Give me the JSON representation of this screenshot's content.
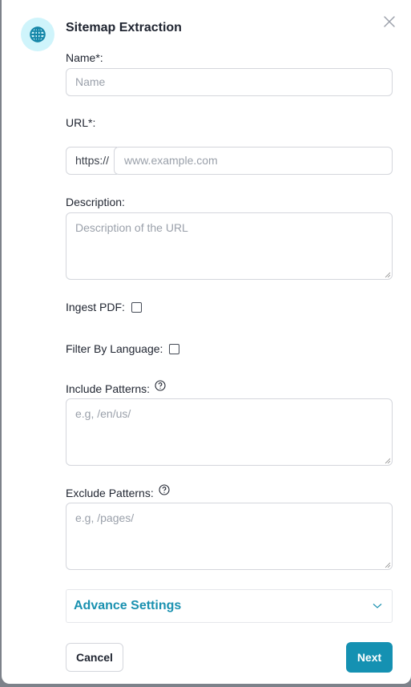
{
  "dialog": {
    "title": "Sitemap Extraction",
    "icon": "globe-icon",
    "close_icon": "close-icon"
  },
  "form": {
    "name": {
      "label": "Name*:",
      "placeholder": "Name",
      "value": ""
    },
    "url": {
      "label": "URL*:",
      "prefix": "https://",
      "placeholder": "www.example.com",
      "value": ""
    },
    "description": {
      "label": "Description:",
      "placeholder": "Description of the URL",
      "value": ""
    },
    "ingest_pdf": {
      "label": "Ingest PDF:",
      "checked": false
    },
    "filter_by_language": {
      "label": "Filter By Language:",
      "checked": false
    },
    "include_patterns": {
      "label": "Include Patterns:",
      "placeholder": "e.g, /en/us/",
      "value": "",
      "help_icon": "help-circle-icon"
    },
    "exclude_patterns": {
      "label": "Exclude Patterns:",
      "placeholder": "e.g, /pages/",
      "value": "",
      "help_icon": "help-circle-icon"
    }
  },
  "advanced": {
    "label": "Advance Settings",
    "expanded": false
  },
  "footer": {
    "cancel_label": "Cancel",
    "next_label": "Next"
  },
  "colors": {
    "accent": "#1591b2",
    "icon_bg": "#cff4fb",
    "accent_text": "#1a91b0"
  }
}
